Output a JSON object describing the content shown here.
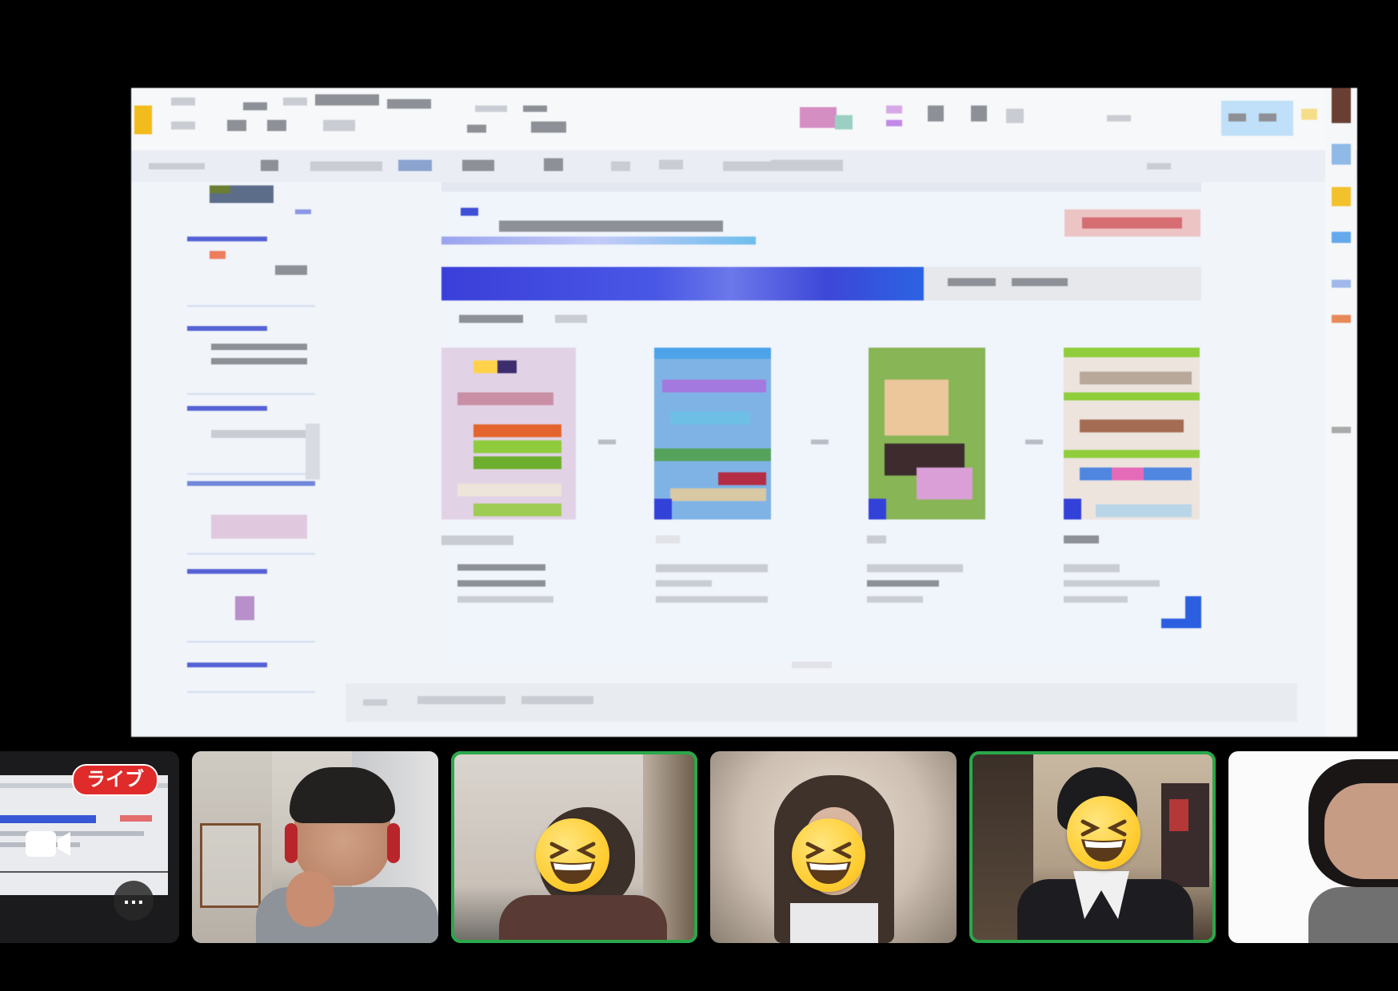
{
  "screen_share": {
    "presenter_app": "presentation-editor"
  },
  "participants": [
    {
      "id": "self-share-preview",
      "badge": "ライブ",
      "more_label": "…",
      "active": false
    },
    {
      "id": "participant-2",
      "active": false
    },
    {
      "id": "participant-3",
      "active": true
    },
    {
      "id": "participant-4",
      "active": false
    },
    {
      "id": "participant-5",
      "active": true
    },
    {
      "id": "participant-6",
      "active": false
    }
  ],
  "icons": {
    "camera": "video-camera-icon",
    "more": "more-options-icon",
    "emoji": "grinning-squinting-face-icon"
  },
  "colors": {
    "active_speaker": "#2aa84a",
    "live_badge": "#e02b2b",
    "banner_blue": "#3a3fd9"
  }
}
